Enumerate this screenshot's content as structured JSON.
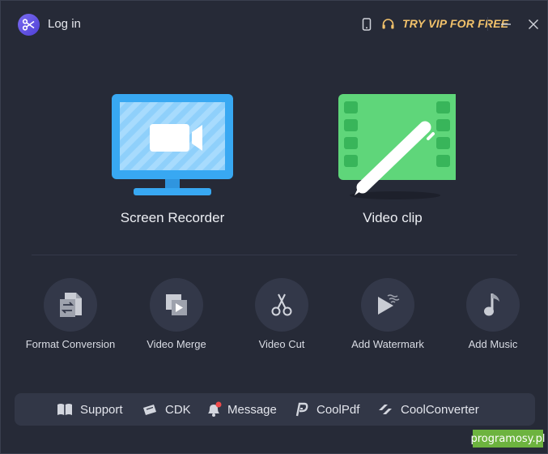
{
  "titlebar": {
    "login_label": "Log in",
    "vip_label": "TRY VIP FOR FREE"
  },
  "main": {
    "screen_recorder_label": "Screen Recorder",
    "video_clip_label": "Video clip"
  },
  "tools": [
    {
      "label": "Format Conversion",
      "icon": "file-convert-icon"
    },
    {
      "label": "Video Merge",
      "icon": "video-merge-icon"
    },
    {
      "label": "Video Cut",
      "icon": "scissors-icon"
    },
    {
      "label": "Add Watermark",
      "icon": "watermark-icon"
    },
    {
      "label": "Add Music",
      "icon": "music-note-icon"
    }
  ],
  "bottombar": [
    {
      "label": "Support",
      "icon": "book-icon"
    },
    {
      "label": "CDK",
      "icon": "ticket-icon"
    },
    {
      "label": "Message",
      "icon": "bell-icon"
    },
    {
      "label": "CoolPdf",
      "icon": "coolpdf-icon"
    },
    {
      "label": "CoolConverter",
      "icon": "coolconverter-icon"
    }
  ],
  "watermark_text": "programosy.pl",
  "colors": {
    "background": "#262a37",
    "vip": "#f2c26b",
    "recorder_blue": "#38a8f2",
    "clip_green": "#5fd67a",
    "notification_dot": "#f04b4b"
  }
}
